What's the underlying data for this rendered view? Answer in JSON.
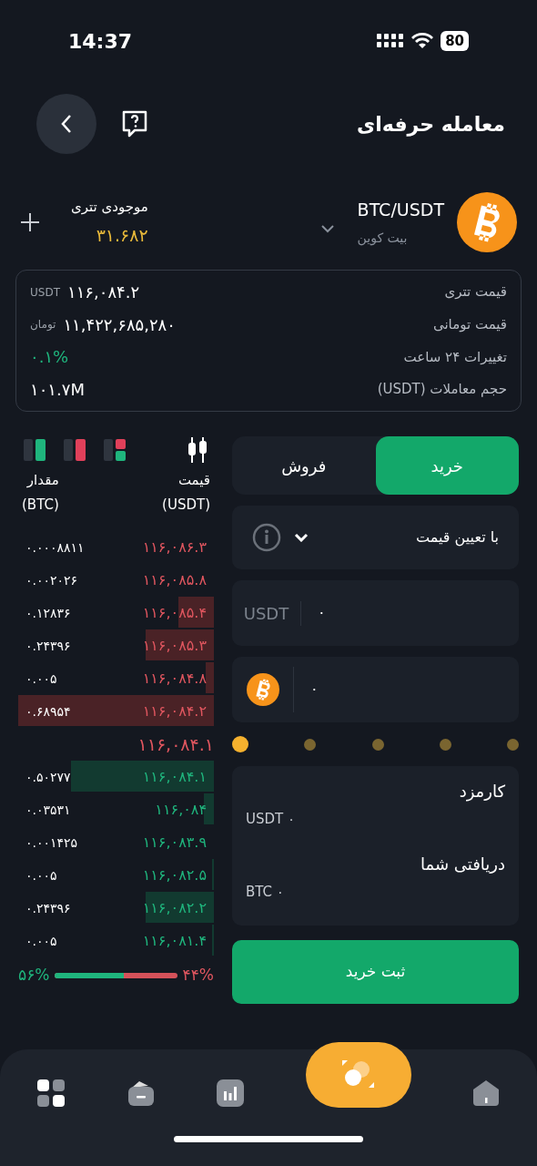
{
  "status_bar": {
    "time": "14:37",
    "battery": "80"
  },
  "header": {
    "title": "معامله حرفه‌ای"
  },
  "market": {
    "pair": "BTC/USDT",
    "name": "بیت کوین",
    "balance_label": "موجودی تتری",
    "balance": "۳۱.۶۸۲"
  },
  "stats": [
    {
      "label": "قیمت تتری",
      "value": "۱۱۶,۰۸۴.۲",
      "unit": "USDT",
      "kind": "plain"
    },
    {
      "label": "قیمت تومانی",
      "value": "۱۱,۴۲۲,۶۸۵,۲۸۰",
      "unit": "تومان",
      "kind": "plain"
    },
    {
      "label": "تغییرات ۲۴ ساعت",
      "value": "۰.۱%",
      "kind": "positive"
    },
    {
      "label": "حجم معاملات (USDT)",
      "value": "۱۰۱.۷M",
      "kind": "plain"
    }
  ],
  "order_book": {
    "price_header": "قیمت",
    "price_unit": "(USDT)",
    "amount_header": "مقدار",
    "amount_unit": "(BTC)",
    "asks": [
      {
        "price": "۱۱۶,۰۸۶.۳",
        "amount": "۰.۰۰۰۸۸۱۱",
        "level": 0
      },
      {
        "price": "۱۱۶,۰۸۵.۸",
        "amount": "۰.۰۰۲۰۲۶",
        "level": 0
      },
      {
        "price": "۱۱۶,۰۸۵.۴",
        "amount": "۰.۱۲۸۳۶",
        "level": 0.18
      },
      {
        "price": "۱۱۶,۰۸۵.۳",
        "amount": "۰.۲۴۳۹۶",
        "level": 0.35
      },
      {
        "price": "۱۱۶,۰۸۴.۸",
        "amount": "۰.۰۰۵",
        "level": 0.04
      },
      {
        "price": "۱۱۶,۰۸۴.۲",
        "amount": "۰.۶۸۹۵۴",
        "level": 1
      }
    ],
    "last_price": "۱۱۶,۰۸۴.۱",
    "bids": [
      {
        "price": "۱۱۶,۰۸۴.۱",
        "amount": "۰.۵۰۲۷۷",
        "level": 0.73
      },
      {
        "price": "۱۱۶,۰۸۴",
        "amount": "۰.۰۳۵۳۱",
        "level": 0.05
      },
      {
        "price": "۱۱۶,۰۸۳.۹",
        "amount": "۰.۰۰۱۴۲۵",
        "level": 0
      },
      {
        "price": "۱۱۶,۰۸۲.۵",
        "amount": "۰.۰۰۵",
        "level": 0.01
      },
      {
        "price": "۱۱۶,۰۸۲.۲",
        "amount": "۰.۲۴۳۹۶",
        "level": 0.35
      },
      {
        "price": "۱۱۶,۰۸۱.۴",
        "amount": "۰.۰۰۵",
        "level": 0.01
      }
    ],
    "buy_ratio": "۵۶%",
    "sell_ratio": "۴۴%",
    "level": 0.56
  },
  "form": {
    "tabs": [
      {
        "label": "خرید",
        "selected": true
      },
      {
        "label": "فروش",
        "selected": false
      }
    ],
    "order_type": "با تعیین قیمت",
    "price_unit": "USDT",
    "price_value": "۰",
    "amount_value": "۰",
    "slider": {
      "level": 0
    },
    "fee_label": "کارمزد",
    "fee_value": "USDT ۰",
    "receive_label": "دریافتی شما",
    "receive_value": "BTC ۰",
    "submit": "ثبت خرید"
  }
}
